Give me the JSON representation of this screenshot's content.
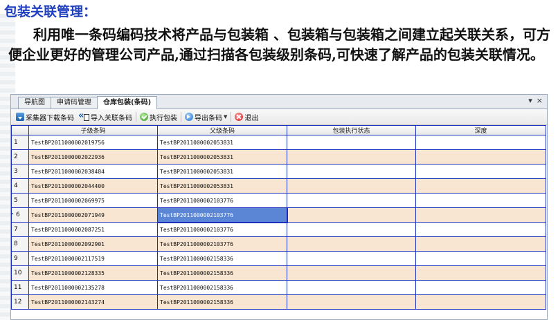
{
  "doc": {
    "title": "包装关联管理：",
    "paragraph": "利用唯一条码编码技术将产品与包装箱 、包装箱与包装箱之间建立起关联关系，可方便企业更好的管理公司产品,通过扫描各包装级别条码,可快速了解产品的包装关联情况。"
  },
  "tabs": [
    {
      "label": "导航图"
    },
    {
      "label": "申请码管理"
    },
    {
      "label": "仓库包装(条码)"
    }
  ],
  "tab_controls": {
    "dropdown": "▾",
    "close": "×"
  },
  "toolbar": {
    "download_label": "采集器下载条码",
    "import_label": "导入关联条码",
    "run_label": "执行包装",
    "export_label": "导出条码",
    "exit_label": "退出"
  },
  "grid": {
    "columns": [
      "子级条码",
      "父级条码",
      "包装执行状态",
      "深度"
    ],
    "rows": [
      {
        "num": "1",
        "child": "TestBP2011000002019756",
        "parent": "TestBP2011000002053831",
        "status": "",
        "depth": ""
      },
      {
        "num": "2",
        "child": "TestBP2011000002022936",
        "parent": "TestBP2011000002053831",
        "status": "",
        "depth": ""
      },
      {
        "num": "3",
        "child": "TestBP2011000002038484",
        "parent": "TestBP2011000002053831",
        "status": "",
        "depth": ""
      },
      {
        "num": "4",
        "child": "TestBP2011000002044400",
        "parent": "TestBP2011000002053831",
        "status": "",
        "depth": ""
      },
      {
        "num": "5",
        "child": "TestBP2011000002069975",
        "parent": "TestBP2011000002103776",
        "status": "",
        "depth": ""
      },
      {
        "num": "6",
        "child": "TestBP2011000002071949",
        "parent": "TestBP2011000002103776",
        "status": "",
        "depth": ""
      },
      {
        "num": "7",
        "child": "TestBP2011000002087251",
        "parent": "TestBP2011000002103776",
        "status": "",
        "depth": ""
      },
      {
        "num": "8",
        "child": "TestBP2011000002092901",
        "parent": "TestBP2011000002103776",
        "status": "",
        "depth": ""
      },
      {
        "num": "9",
        "child": "TestBP2011000002117519",
        "parent": "TestBP2011000002158336",
        "status": "",
        "depth": ""
      },
      {
        "num": "10",
        "child": "TestBP2011000002128335",
        "parent": "TestBP2011000002158336",
        "status": "",
        "depth": ""
      },
      {
        "num": "11",
        "child": "TestBP2011000002135278",
        "parent": "TestBP2011000002158336",
        "status": "",
        "depth": ""
      },
      {
        "num": "12",
        "child": "TestBP2011000002143274",
        "parent": "TestBP2011000002158336",
        "status": "",
        "depth": ""
      }
    ]
  }
}
